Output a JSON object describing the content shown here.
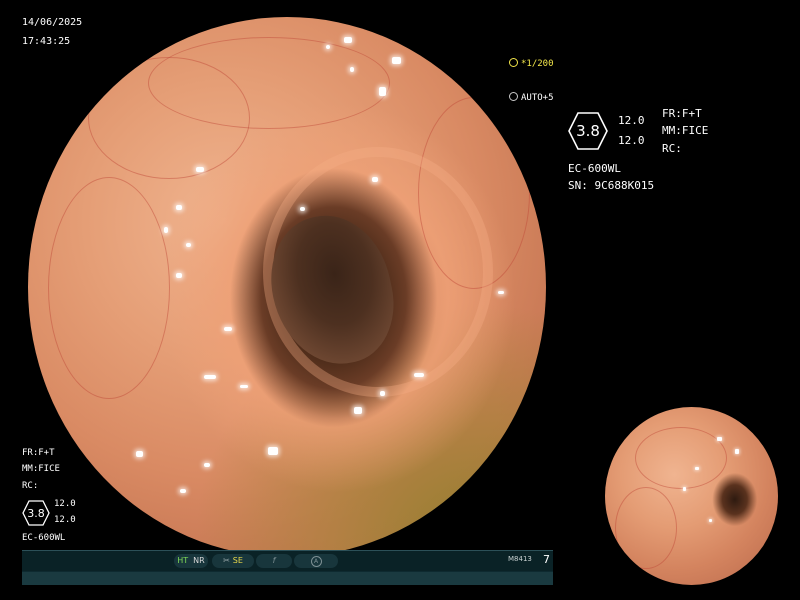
{
  "overlay": {
    "date": "14/06/2025",
    "time": "17:43:25",
    "shutter": "*1/200",
    "auto": "AUTO+5",
    "right_block": {
      "hex_value": "3.8",
      "value1": "12.0",
      "value2": "12.0",
      "fr": "FR:F+T",
      "mm": "MM:FICE",
      "rc": "RC:",
      "model": "EC-600WL",
      "serial": "SN: 9C688K015"
    },
    "left_block": {
      "fr": "FR:F+T",
      "mm": "MM:FICE",
      "rc": "RC:",
      "hex_value": "3.8",
      "value1": "12.0",
      "value2": "12.0",
      "model": "EC-600WL"
    }
  },
  "status_bar": {
    "ht": "HT",
    "nr": "NR",
    "se": "SE",
    "f_label": "f",
    "a_label": "A",
    "code": "M8413",
    "number": "7"
  },
  "colors": {
    "accent_yellow": "#f2e64a",
    "ht_green": "#7ed957",
    "status_bg": "#0e2a30",
    "mucosa": "#e59e76"
  },
  "icons": {
    "shutter": "camera-shutter-icon",
    "auto": "auto-exposure-icon",
    "hex": "hexagon-badge-icon",
    "scissors": "scissors-icon",
    "f": "function-icon",
    "a": "circled-a-icon"
  }
}
